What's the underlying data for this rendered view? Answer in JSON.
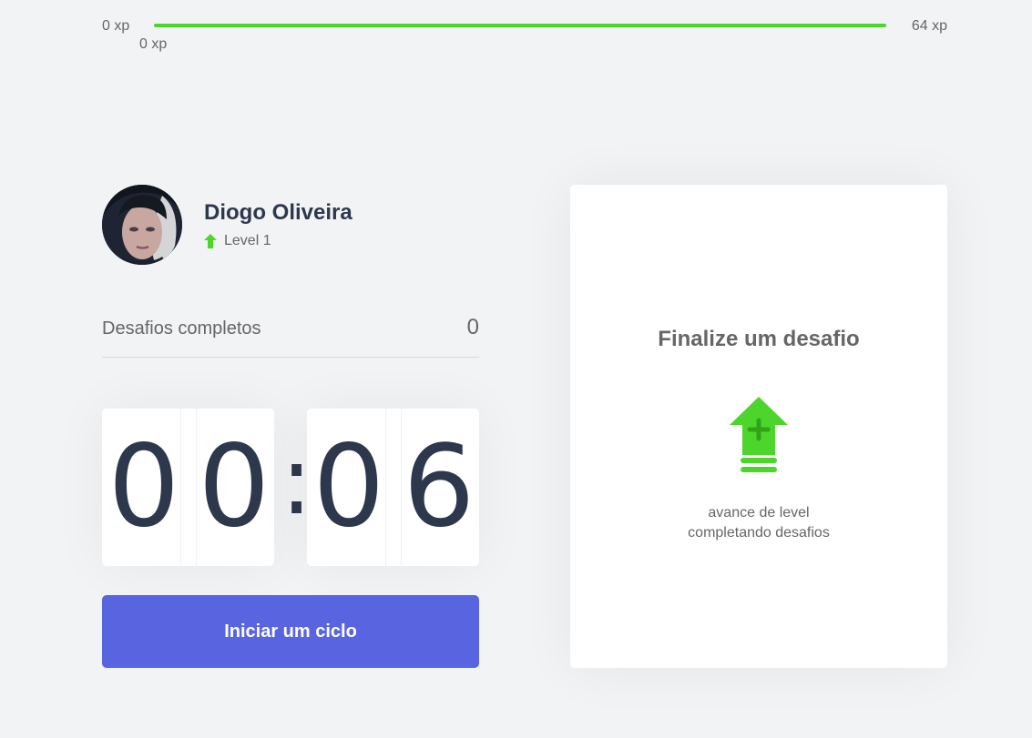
{
  "experience": {
    "min_label": "0 xp",
    "max_label": "64 xp",
    "current_label": "0 xp",
    "progress_fraction": 1
  },
  "profile": {
    "name": "Diogo Oliveira",
    "level_label": "Level 1"
  },
  "completed_challenges": {
    "label": "Desafios completos",
    "count": "0"
  },
  "countdown": {
    "minute_left": "0",
    "minute_right": "0",
    "separator": ":",
    "second_left": "0",
    "second_right": "6"
  },
  "actions": {
    "start_cycle_label": "Iniciar um ciclo"
  },
  "challenge_box": {
    "title": "Finalize um desafio",
    "description_line_1": "avance de level",
    "description_line_2": "completando desafios"
  },
  "colors": {
    "accent_green": "#4cd62b",
    "button_blue": "#5965e0",
    "text_dark": "#2e384d",
    "text_muted": "#666666",
    "background": "#f1f3f5"
  },
  "icons": {
    "avatar": "profile-photo",
    "level": "level-up-arrow-icon",
    "challenge": "level-up-large-icon"
  }
}
